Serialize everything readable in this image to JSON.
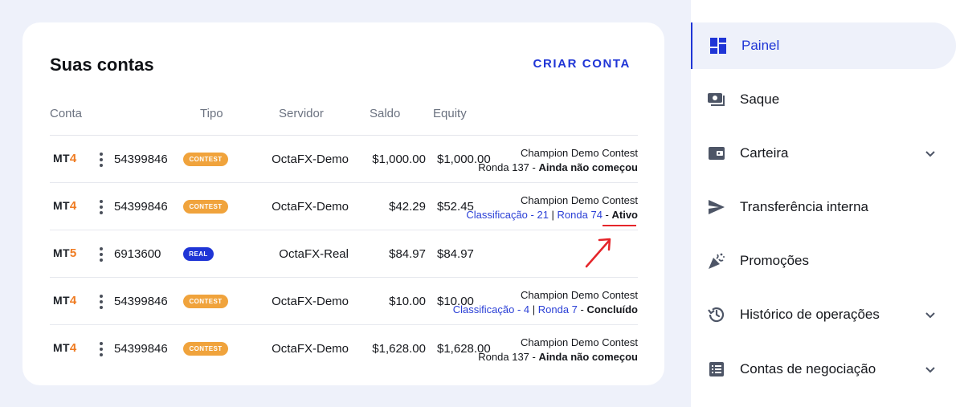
{
  "accounts_card": {
    "title": "Suas contas",
    "create_button": "CRIAR CONTA",
    "headers": {
      "conta": "Conta",
      "tipo": "Tipo",
      "servidor": "Servidor",
      "saldo": "Saldo",
      "equity": "Equity"
    },
    "rows": [
      {
        "platform_prefix": "MT",
        "platform_num": "4",
        "account": "54399846",
        "type": "CONTEST",
        "server": "OctaFX-Demo",
        "balance": "$1,000.00",
        "equity": "$1,000.00",
        "contest_name": "Champion Demo Contest",
        "round_prefix": "Ronda 137 - ",
        "status": "Ainda não começou"
      },
      {
        "platform_prefix": "MT",
        "platform_num": "4",
        "account": "54399846",
        "type": "CONTEST",
        "server": "OctaFX-Demo",
        "balance": "$42.29",
        "equity": "$52.45",
        "contest_name": "Champion Demo Contest",
        "ranking": "Classificação - 21",
        "separator": " | ",
        "round": "Ronda 74",
        "status_sep": " - ",
        "status": "Ativo"
      },
      {
        "platform_prefix": "MT",
        "platform_num": "5",
        "account": "6913600",
        "type": "REAL",
        "server": "OctaFX-Real",
        "balance": "$84.97",
        "equity": "$84.97"
      },
      {
        "platform_prefix": "MT",
        "platform_num": "4",
        "account": "54399846",
        "type": "CONTEST",
        "server": "OctaFX-Demo",
        "balance": "$10.00",
        "equity": "$10.00",
        "contest_name": "Champion Demo Contest",
        "ranking": "Classificação - 4",
        "separator": " | ",
        "round": "Ronda 7",
        "status_sep": " - ",
        "status": "Concluído"
      },
      {
        "platform_prefix": "MT",
        "platform_num": "4",
        "account": "54399846",
        "type": "CONTEST",
        "server": "OctaFX-Demo",
        "balance": "$1,628.00",
        "equity": "$1,628.00",
        "contest_name": "Champion Demo Contest",
        "round_prefix": "Ronda 137 - ",
        "status": "Ainda não começou"
      }
    ]
  },
  "sidebar": {
    "items": [
      {
        "label": "Painel",
        "icon": "dashboard-icon",
        "active": true
      },
      {
        "label": "Saque",
        "icon": "cash-icon"
      },
      {
        "label": "Carteira",
        "icon": "wallet-icon",
        "expandable": true
      },
      {
        "label": "Transferência interna",
        "icon": "send-icon"
      },
      {
        "label": "Promoções",
        "icon": "party-popper-icon"
      },
      {
        "label": "Histórico de operações",
        "icon": "history-icon",
        "expandable": true
      },
      {
        "label": "Contas de negociação",
        "icon": "list-icon",
        "expandable": true
      }
    ]
  },
  "colors": {
    "accent": "#1f35d6",
    "contest_badge": "#f0a33c",
    "mt_orange": "#ef7b21",
    "annotation_red": "#e5252a"
  }
}
